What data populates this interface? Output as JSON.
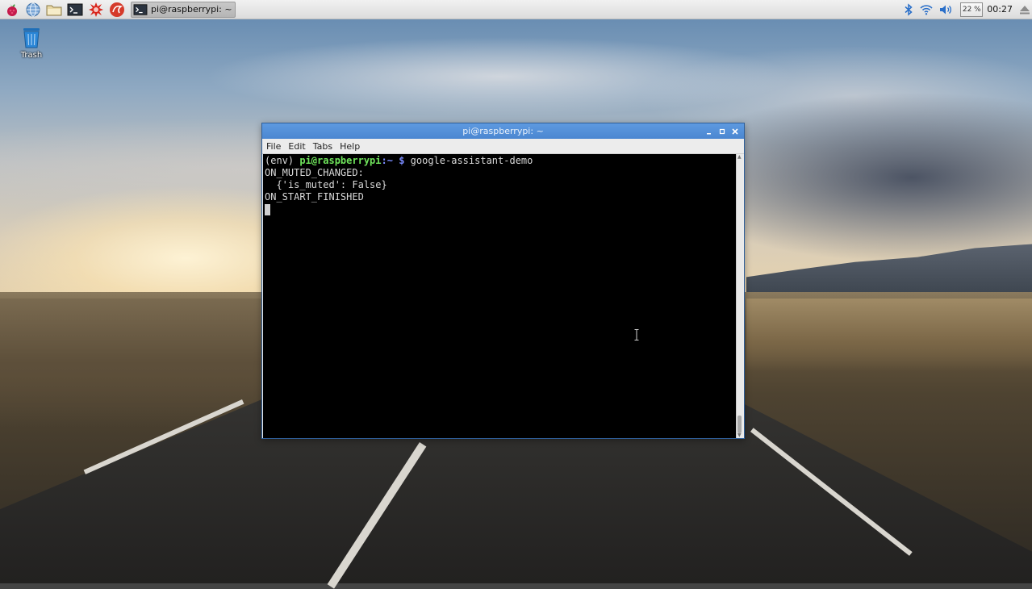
{
  "taskbar": {
    "launchers": [
      {
        "icon": "raspberry-menu-icon"
      },
      {
        "icon": "web-browser-globe-icon"
      },
      {
        "icon": "file-manager-folder-icon"
      },
      {
        "icon": "terminal-icon"
      },
      {
        "icon": "wolfram-mathematica-icon"
      },
      {
        "icon": "mathematica-red-icon"
      }
    ],
    "active_task": {
      "icon": "terminal-icon",
      "label": "pi@raspberrypi: ~"
    },
    "tray": {
      "bluetooth_icon": "bluetooth-icon",
      "wifi_icon": "wifi-icon",
      "volume_icon": "volume-icon",
      "cpu_usage": "22 %",
      "clock": "00:27",
      "eject_icon": "eject-icon"
    }
  },
  "desktop": {
    "icons": [
      {
        "label": "Trash",
        "icon": "trash-icon"
      }
    ]
  },
  "window": {
    "title": "pi@raspberrypi: ~",
    "controls": [
      "minimize",
      "maximize",
      "close"
    ],
    "menu": [
      "File",
      "Edit",
      "Tabs",
      "Help"
    ],
    "terminal": {
      "prompt_env": "(env) ",
      "prompt_user_host": "pi@raspberrypi",
      "prompt_path": ":~ $",
      "command": " google-assistant-demo",
      "output": [
        "ON_MUTED_CHANGED:",
        "  {'is_muted': False}",
        "ON_START_FINISHED"
      ]
    }
  },
  "colors": {
    "titlebar": "#4a86d1",
    "prompt_green": "#6fe35b",
    "prompt_blue": "#7b8cff",
    "terminal_bg": "#000000"
  }
}
